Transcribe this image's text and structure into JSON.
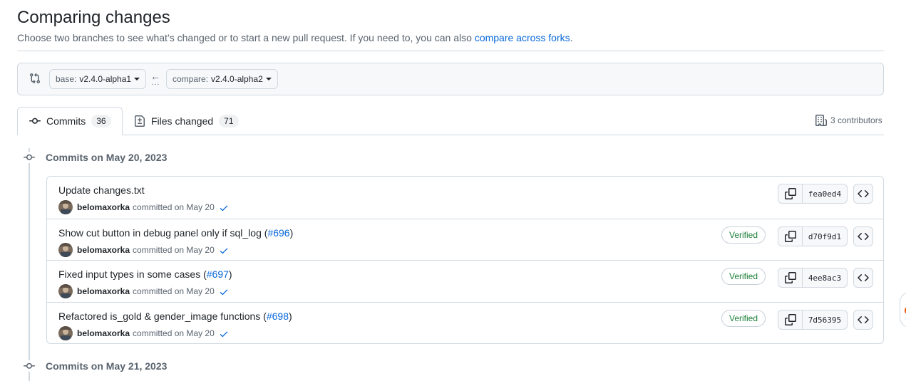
{
  "header": {
    "title": "Comparing changes",
    "subtitle_text": "Choose two branches to see what’s changed or to start a new pull request. If you need to, you can also",
    "subtitle_link": "compare across forks",
    "subtitle_end": "."
  },
  "range": {
    "base_prefix": "base:",
    "base_value": "v2.4.0-alpha1",
    "compare_prefix": "compare:",
    "compare_value": "v2.4.0-alpha2",
    "arrow": "←",
    "dots": "..."
  },
  "tabs": {
    "commits_label": "Commits",
    "commits_count": "36",
    "files_label": "Files changed",
    "files_count": "71",
    "contributors": "3 contributors"
  },
  "groups": [
    {
      "title": "Commits on May 20, 2023"
    },
    {
      "title": "Commits on May 21, 2023"
    }
  ],
  "commits": [
    {
      "title": "Update changes.txt",
      "pr": "",
      "pr_close": "",
      "author": "belomaxorka",
      "meta": "committed on May 20",
      "verified": "",
      "sha": "fea0ed4"
    },
    {
      "title": "Show cut button in debug panel only if sql_log (",
      "pr": "#696",
      "pr_close": ")",
      "author": "belomaxorka",
      "meta": "committed on May 20",
      "verified": "Verified",
      "sha": "d70f9d1"
    },
    {
      "title": "Fixed input types in some cases (",
      "pr": "#697",
      "pr_close": ")",
      "author": "belomaxorka",
      "meta": "committed on May 20",
      "verified": "Verified",
      "sha": "4ee8ac3"
    },
    {
      "title": "Refactored is_gold & gender_image functions (",
      "pr": "#698",
      "pr_close": ")",
      "author": "belomaxorka",
      "meta": "committed on May 20",
      "verified": "Verified",
      "sha": "7d56395"
    }
  ],
  "colors": {
    "link": "#0969da",
    "success": "#1a7f37",
    "border": "#d1d9e0",
    "muted": "#59636e"
  },
  "icons": {
    "range": "git-compare-icon",
    "commit": "git-commit-icon",
    "files": "file-diff-icon",
    "contributors": "organization-icon",
    "copy": "copy-icon",
    "browse": "code-icon",
    "check": "check-icon"
  }
}
